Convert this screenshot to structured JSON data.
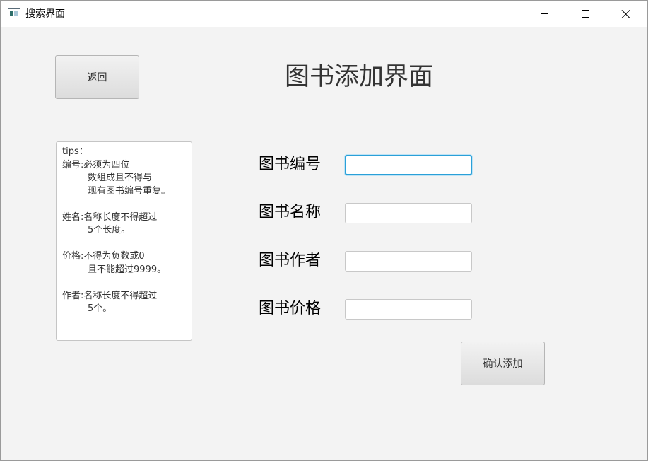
{
  "window": {
    "title": "搜索界面",
    "icon": "app-window-icon",
    "controls": [
      "minimize-icon",
      "maximize-icon",
      "close-icon"
    ]
  },
  "header": {
    "back_label": "返回",
    "page_title": "图书添加界面"
  },
  "tips": {
    "heading": "tips：",
    "items": [
      {
        "key": "编号:",
        "lines": [
          "必须为四位",
          "数组成且不得与",
          "现有图书编号重复。"
        ]
      },
      {
        "key": "姓名:",
        "lines": [
          "名称长度不得超过",
          "5个长度。"
        ]
      },
      {
        "key": "价格:",
        "lines": [
          "不得为负数或0",
          "且不能超过9999。"
        ]
      },
      {
        "key": "作者:",
        "lines": [
          "名称长度不得超过",
          "5个。"
        ]
      }
    ]
  },
  "form": {
    "fields": [
      {
        "label": "图书编号",
        "value": "",
        "focused": true
      },
      {
        "label": "图书名称",
        "value": ""
      },
      {
        "label": "图书作者",
        "value": ""
      },
      {
        "label": "图书价格",
        "value": ""
      }
    ],
    "submit_label": "确认添加"
  },
  "colors": {
    "window_bg": "#f3f3f3",
    "focus_ring": "#2aa0d8"
  }
}
